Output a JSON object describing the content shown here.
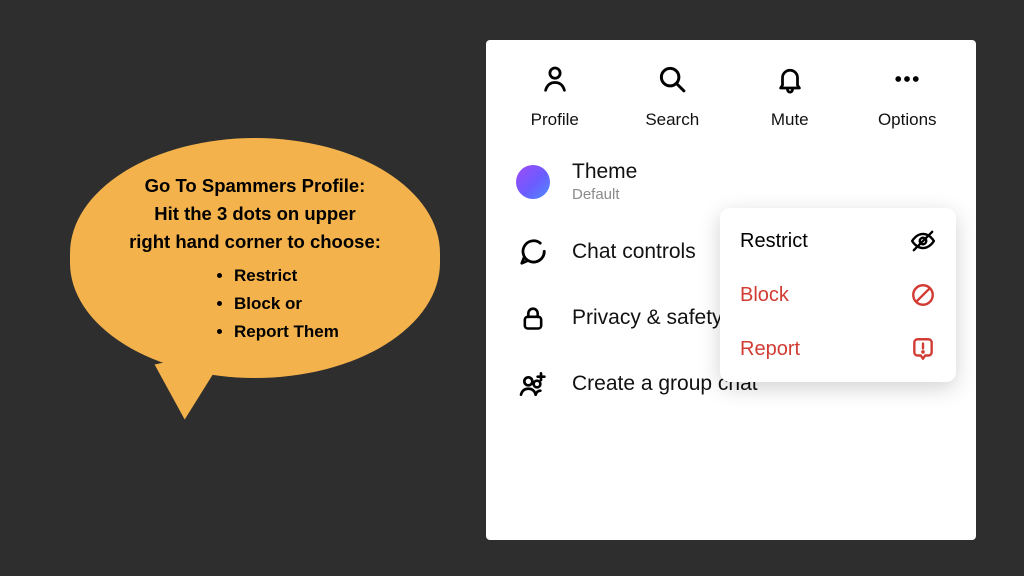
{
  "bubble": {
    "line1": "Go To Spammers Profile:",
    "line2": "Hit the 3 dots on upper",
    "line3": "right hand corner to choose:",
    "bullets": [
      "Restrict",
      "Block or",
      "Report Them"
    ]
  },
  "toolbar": {
    "profile": "Profile",
    "search": "Search",
    "mute": "Mute",
    "options": "Options"
  },
  "settings": {
    "theme_label": "Theme",
    "theme_value": "Default",
    "chat_controls": "Chat controls",
    "privacy": "Privacy & safety",
    "group": "Create a group chat"
  },
  "menu": {
    "restrict": "Restrict",
    "block": "Block",
    "report": "Report"
  }
}
